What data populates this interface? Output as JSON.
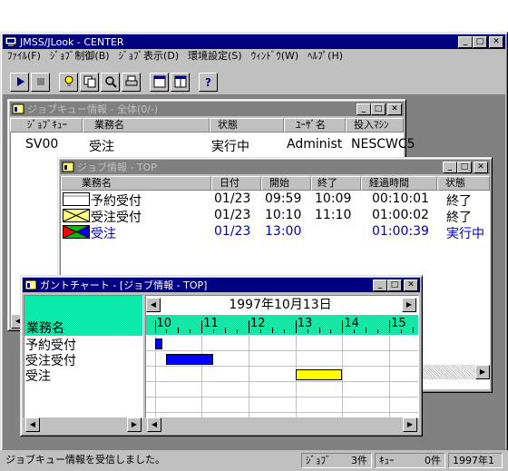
{
  "main": {
    "title": "JMSS/JLook - CENTER",
    "menu": [
      "ﾌｧｲﾙ(F)",
      "ｼﾞｮﾌﾞ制御(B)",
      "ｼﾞｮﾌﾞ表示(D)",
      "環境設定(S)",
      "ｳｨﾝﾄﾞｳ(W)",
      "ﾍﾙﾌﾟ(H)"
    ]
  },
  "queue": {
    "title": "ジョブキュー情報 - 全体(0/-)",
    "headers": [
      "ｼﾞｮﾌﾞｷｭｰ",
      "業務名",
      "状態",
      "ﾕｰｻﾞ名",
      "投入ﾏｼﾝ"
    ],
    "row": [
      "SV00",
      "受注",
      "実行中",
      "Administ",
      "NESCWC5"
    ]
  },
  "jobs": {
    "title": "ジョブ情報 - TOP",
    "headers": [
      "業務名",
      "日付",
      "開始",
      "終了",
      "経過時間",
      "状態"
    ],
    "rows": [
      {
        "name": "予約受付",
        "date": "01/23",
        "start": "09:59",
        "end": "10:09",
        "elapsed": "00:10:01",
        "status": "終了"
      },
      {
        "name": "受注受付",
        "date": "01/23",
        "start": "10:10",
        "end": "11:10",
        "elapsed": "01:00:02",
        "status": "終了"
      },
      {
        "name": "受注",
        "date": "01/23",
        "start": "13:00",
        "end": "",
        "elapsed": "01:00:39",
        "status": "実行中"
      }
    ]
  },
  "gantt": {
    "title": "ガントチャート - [ジョブ情報 - TOP]",
    "date_label": "1997年10月13日",
    "header_label": "業務名",
    "hours": [
      "10",
      "11",
      "12",
      "13",
      "14",
      "15"
    ],
    "tasks": [
      {
        "name": "予約受付",
        "start_hour": 10.0,
        "end_hour": 10.17,
        "color": "#0000ff"
      },
      {
        "name": "受注受付",
        "start_hour": 10.25,
        "end_hour": 11.25,
        "color": "#0000ff"
      },
      {
        "name": "受注",
        "start_hour": 13.0,
        "end_hour": 14.0,
        "color": "#ffff00"
      }
    ],
    "chart_data": {
      "type": "gantt",
      "x_unit": "hour",
      "xlim": [
        9.7,
        15.5
      ],
      "categories": [
        "予約受付",
        "受注受付",
        "受注"
      ]
    }
  },
  "status": {
    "message": "ジョブキュー情報を受信しました。",
    "jobs_label": "ｼﾞｮﾌﾞ",
    "jobs_count": "3件",
    "queue_label": "ｷｭｰ",
    "queue_count": "0件",
    "date": "1997年1"
  },
  "colors": {
    "titlebar_active": "#000080",
    "titlebar_inactive": "#808080",
    "highlight": "#00e0a0"
  }
}
